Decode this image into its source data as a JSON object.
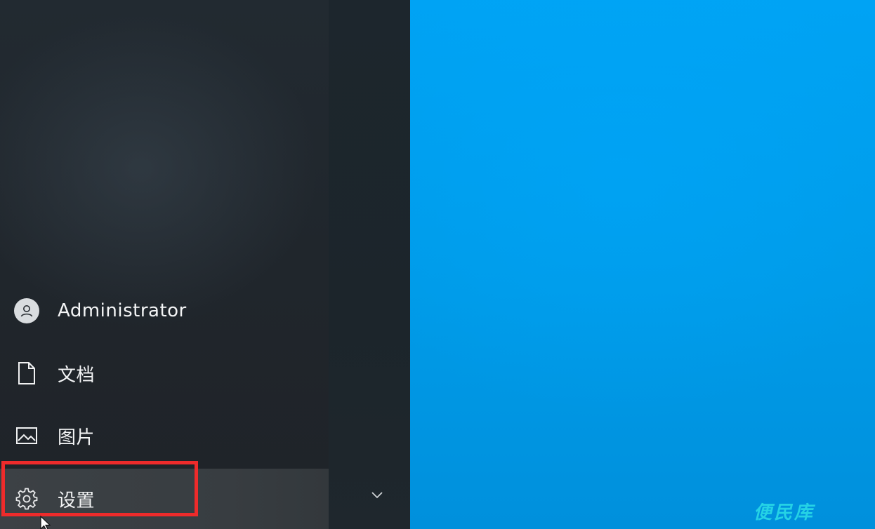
{
  "start_menu": {
    "items": [
      {
        "label": "Administrator",
        "icon": "user-avatar-icon"
      },
      {
        "label": "文档",
        "icon": "document-icon"
      },
      {
        "label": "图片",
        "icon": "image-icon"
      },
      {
        "label": "设置",
        "icon": "gear-icon"
      }
    ],
    "highlighted_item": "设置",
    "expand_icon": "chevron-down-icon"
  },
  "watermark": {
    "text": "便民库"
  },
  "colors": {
    "desktop_blue": "#00a3f4",
    "rail_dark": "#20262c",
    "highlight_red": "#ee2b2b",
    "watermark_cyan": "#27d6e6"
  }
}
